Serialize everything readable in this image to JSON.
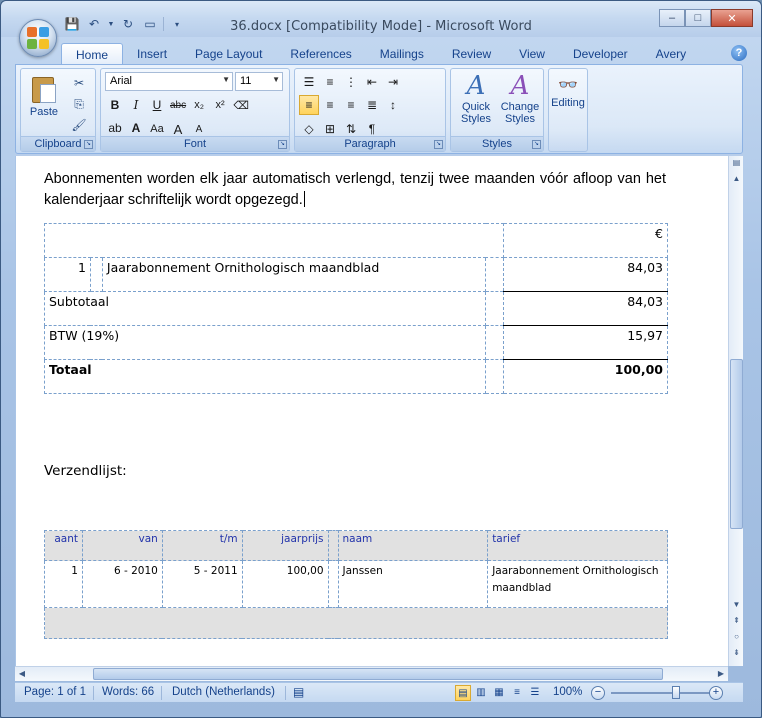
{
  "window": {
    "title": "36.docx [Compatibility Mode] - Microsoft Word",
    "controls": {
      "minimize": "–",
      "maximize": "□",
      "close": "✕"
    }
  },
  "quick_access": {
    "save_icon": "save-icon",
    "undo_icon": "undo-icon",
    "redo_icon": "redo-icon"
  },
  "ribbon": {
    "tabs": [
      {
        "label": "Home",
        "active": true
      },
      {
        "label": "Insert"
      },
      {
        "label": "Page Layout"
      },
      {
        "label": "References"
      },
      {
        "label": "Mailings"
      },
      {
        "label": "Review"
      },
      {
        "label": "View"
      },
      {
        "label": "Developer"
      },
      {
        "label": "Avery"
      }
    ],
    "help": "?",
    "groups": {
      "clipboard": {
        "label": "Clipboard",
        "paste": "Paste"
      },
      "font": {
        "label": "Font",
        "font_name": "Arial",
        "font_size": "11",
        "bold": "B",
        "italic": "I",
        "underline": "U",
        "strike": "abc",
        "subscript": "x₂",
        "superscript": "x²",
        "change_case": "Aa",
        "grow": "A",
        "shrink": "A"
      },
      "paragraph": {
        "label": "Paragraph",
        "pilcrow": "¶"
      },
      "styles": {
        "label": "Styles",
        "quick_styles": "Quick Styles",
        "change_styles": "Change Styles"
      },
      "editing": {
        "label": "Editing",
        "icon": "binoculars-icon"
      }
    }
  },
  "document": {
    "paragraph": "Abonnementen worden elk jaar automatisch verlengd, tenzij twee maanden vóór afloop van het kalenderjaar schriftelijk wordt opgezegd.",
    "invoice": {
      "currency": "€",
      "item": {
        "qty": "1",
        "description": "Jaarabonnement Ornithologisch maandblad",
        "amount": "84,03"
      },
      "subtotal_label": "Subtotaal",
      "subtotal": "84,03",
      "vat_label": "BTW (19%)",
      "vat": "15,97",
      "total_label": "Totaal",
      "total": "100,00"
    },
    "shipping_label": "Verzendlijst:",
    "shipping": {
      "headers": [
        "aant",
        "van",
        "t/m",
        "jaarprijs",
        "naam",
        "tarief"
      ],
      "rows": [
        [
          "1",
          "6 - 2010",
          "5 - 2011",
          "100,00",
          "Janssen",
          "Jaarabonnement Ornithologisch maandblad"
        ]
      ]
    }
  },
  "statusbar": {
    "page": "Page: 1 of 1",
    "words": "Words: 66",
    "language": "Dutch (Netherlands)",
    "zoom": "100%",
    "zoom_level": 0.5
  }
}
